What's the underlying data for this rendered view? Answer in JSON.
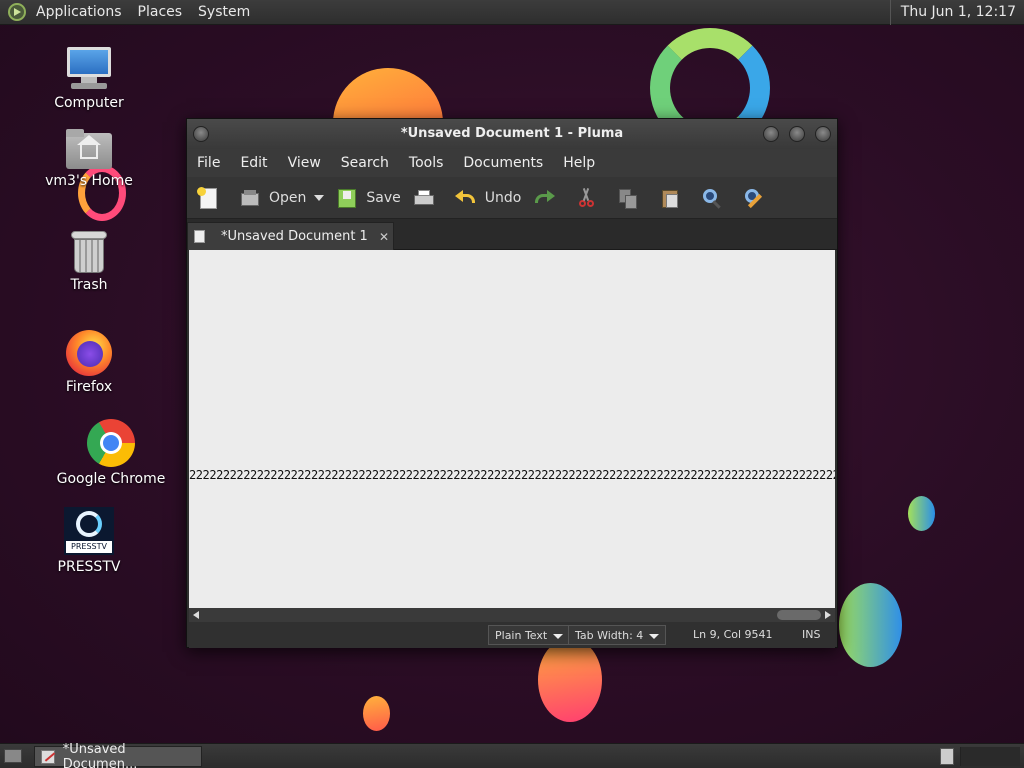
{
  "top_panel": {
    "menus": [
      "Applications",
      "Places",
      "System"
    ],
    "clock": "Thu Jun  1, 12:17"
  },
  "desktop": {
    "icons": [
      {
        "label": "Computer",
        "icon": "computer-icon"
      },
      {
        "label": "vm3's Home",
        "icon": "home-folder-icon"
      },
      {
        "label": "Trash",
        "icon": "trash-icon"
      },
      {
        "label": "Firefox",
        "icon": "firefox-icon"
      },
      {
        "label": "Google Chrome",
        "icon": "chrome-icon"
      },
      {
        "label": "PRESSTV",
        "icon": "presstv-icon"
      }
    ],
    "presstv_logo_text": "PRESSTV"
  },
  "window": {
    "title": "*Unsaved Document 1 - Pluma",
    "menu": [
      "File",
      "Edit",
      "View",
      "Search",
      "Tools",
      "Documents",
      "Help"
    ],
    "toolbar": {
      "open_label": "Open",
      "save_label": "Save",
      "undo_label": "Undo"
    },
    "tab": {
      "label": "*Unsaved Document 1",
      "close": "✕"
    },
    "editor_text": "2222222222222222222222222222222222222222222222222222222222222222222222222222222222222222222222222222222222",
    "status": {
      "language": "Plain Text",
      "tab_width": "Tab Width:  4",
      "position": "Ln 9, Col 9541",
      "mode": "INS"
    }
  },
  "taskbar": {
    "task_label": "*Unsaved Documen..."
  },
  "colors": {
    "desktop_bg": "#2b0d25",
    "panel_bg": "#333333",
    "editor_bg": "#ececec"
  }
}
